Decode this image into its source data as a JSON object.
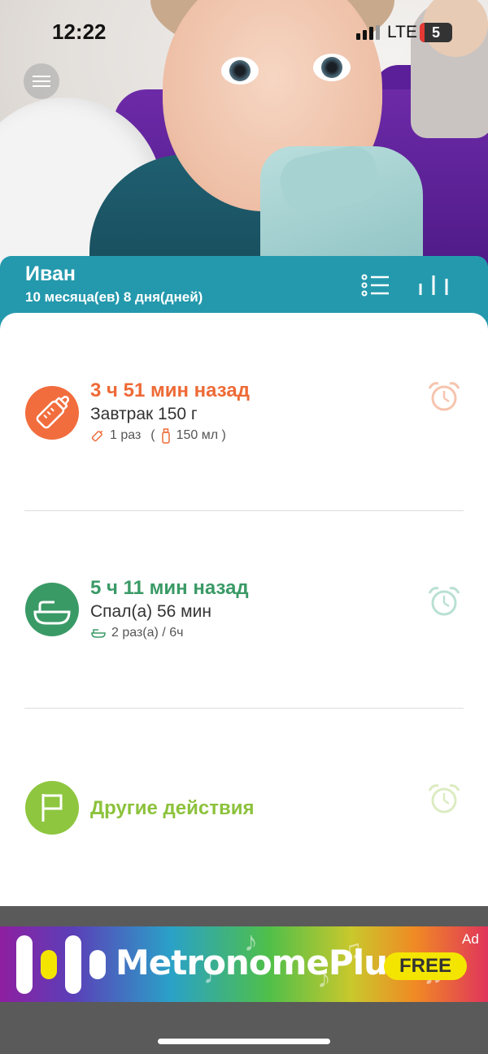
{
  "status_bar": {
    "time": "12:22",
    "network": "LTE",
    "battery": "5"
  },
  "header": {
    "name": "Иван",
    "age": "10 месяца(ев) 8 дня(дней)",
    "color": "#2499ad"
  },
  "entries": [
    {
      "type": "feeding",
      "icon": "baby-bottle-icon",
      "ago": "3 ч 51 мин назад",
      "detail": "Завтрак 150 г",
      "count": "1 раз",
      "paren_open": "(",
      "volume": "150 мл )",
      "color": "#ee6a36"
    },
    {
      "type": "sleep",
      "icon": "crib-icon",
      "ago": "5 ч 11 мин назад",
      "detail": "Спал(а) 56 мин",
      "count": "2 раз(а) / 6ч",
      "color": "#3a9a66"
    },
    {
      "type": "other",
      "icon": "flag-icon",
      "ago": "Другие действия",
      "color": "#8cc23c"
    }
  ],
  "ad": {
    "title": "MetronomePlus",
    "badge": "FREE",
    "label": "Ad"
  }
}
